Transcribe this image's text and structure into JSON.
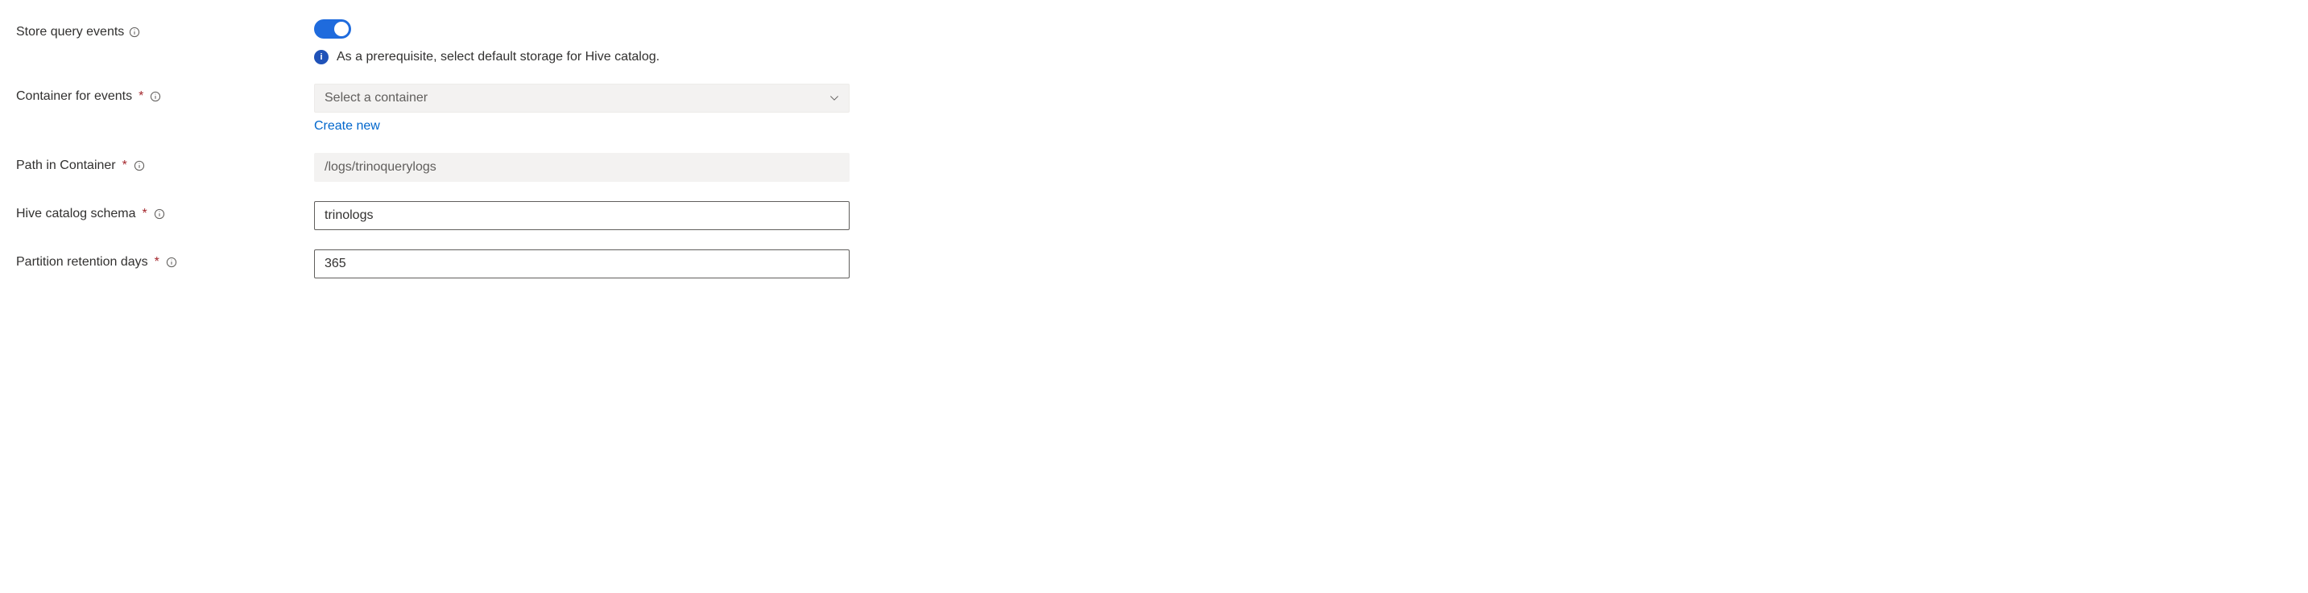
{
  "storeQueryEvents": {
    "label": "Store query events",
    "enabled": true,
    "message": "As a prerequisite, select default storage for Hive catalog."
  },
  "containerForEvents": {
    "label": "Container for events",
    "required": true,
    "placeholder": "Select a container",
    "value": "",
    "createNewLabel": "Create new"
  },
  "pathInContainer": {
    "label": "Path in Container",
    "required": true,
    "placeholder": "/logs/trinoquerylogs",
    "value": ""
  },
  "hiveCatalogSchema": {
    "label": "Hive catalog schema",
    "required": true,
    "value": "trinologs"
  },
  "partitionRetentionDays": {
    "label": "Partition retention days",
    "required": true,
    "value": "365"
  }
}
